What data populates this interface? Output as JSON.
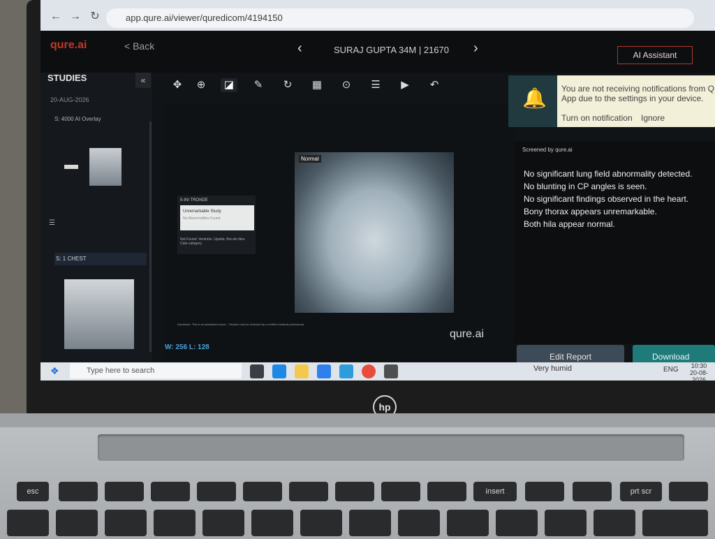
{
  "browser": {
    "url": "app.qure.ai/viewer/quredicom/4194150",
    "back_icon": "←",
    "forward_icon": "→",
    "reload_icon": "↻"
  },
  "app": {
    "logo": "qure.ai",
    "back_label": "< Back",
    "patient": "SURAJ GUPTA 34M | 21670",
    "prev": "‹",
    "next": "›",
    "ai_assistant": "AI Assistant"
  },
  "sidebar": {
    "title": "STUDIES",
    "collapse": "«",
    "date": "20-AUG-2026",
    "series1": "S: 4000    AI Overlay",
    "series2": "S: 1    CHEST"
  },
  "viewer": {
    "normal_tag": "Normal",
    "overlay_title": "5-INI TRONDE",
    "overlay_line1": "Unremarkable Study",
    "overlay_line2": "No Abnormalities Found",
    "overlay_foot": "Not Found: Ventricle. Upside. Bor.ele tiles. Cate.category",
    "window_level": "W: 256 L: 128",
    "watermark": "qure.ai",
    "disclaimer": "Disclaimer: This is an automated report... Results must be reviewed by a certified medical professional."
  },
  "notification": {
    "text": "You are not receiving notifications from Q App due to the settings in your device.",
    "turn_on": "Turn on notification",
    "ignore": "Ignore"
  },
  "report": {
    "screened_by": "Screened by qure.ai",
    "findings": [
      "No significant lung field abnormality detected.",
      "No blunting in CP angles is seen.",
      "No significant findings observed in the heart.",
      "Bony thorax appears unremarkable.",
      "Both hila appear normal."
    ],
    "edit_label": "Edit Report",
    "download_label": "Download Report"
  },
  "taskbar": {
    "search_placeholder": "Type here to search",
    "weather": "Very humid",
    "lang": "ENG",
    "time": "10:30",
    "date": "20-08-2026"
  },
  "laptop": {
    "brand": "hp"
  }
}
